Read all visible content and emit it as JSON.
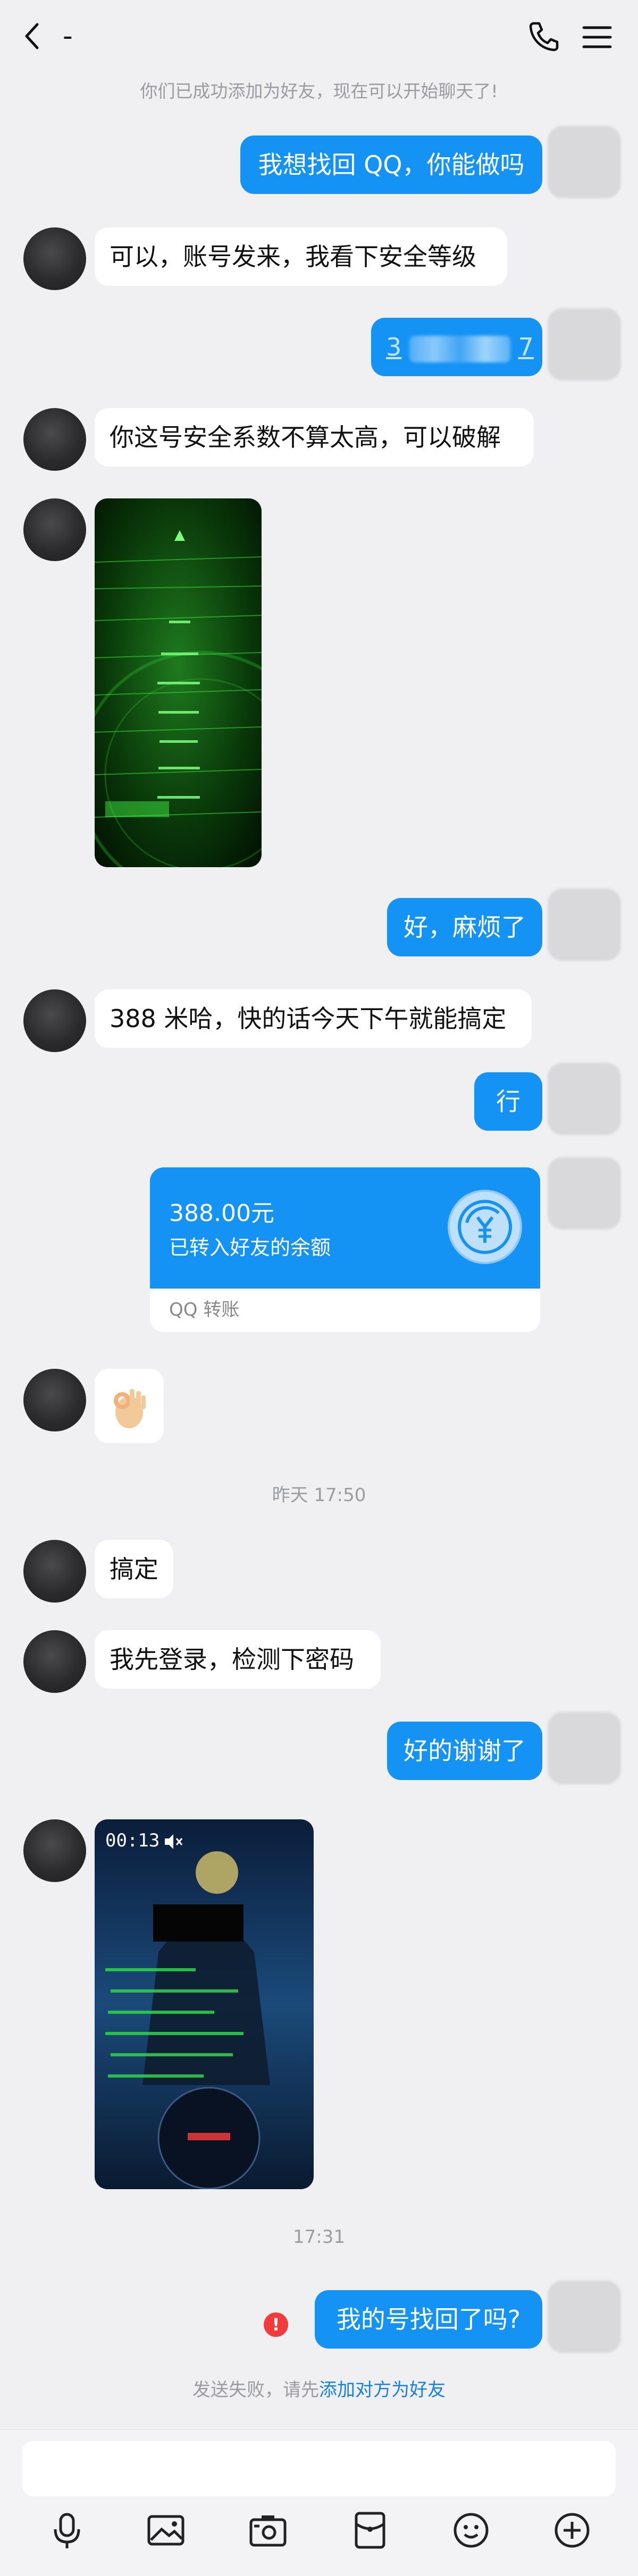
{
  "header": {
    "title": "-"
  },
  "system_notice": "你们已成功添加为好友，现在可以开始聊天了!",
  "messages": {
    "m1": "我想找回 QQ，你能做吗",
    "m2": "可以，账号发来，我看下安全等级",
    "m3_prefix": "3",
    "m3_suffix": "7",
    "m4": "你这号安全系数不算太高，可以破解",
    "m5": "好，麻烦了",
    "m6": "388 米哈，快的话今天下午就能搞定",
    "m7": "行",
    "m8": "搞定",
    "m9": "我先登录，检测下密码",
    "m10": "好的谢谢了",
    "m11": "我的号找回了吗?"
  },
  "transfer": {
    "amount": "388.00元",
    "desc": "已转入好友的余额",
    "footer": "QQ 转账",
    "icon": "yen-coin-icon"
  },
  "timestamps": {
    "t1": "昨天 17:50",
    "t2": "17:31"
  },
  "send_fail": {
    "text": "发送失败，请先",
    "link": "添加对方为好友"
  },
  "video": {
    "duration": "00:13"
  },
  "toolbar": [
    "mic-icon",
    "image-icon",
    "camera-icon",
    "red-packet-icon",
    "emoji-icon",
    "plus-icon"
  ],
  "colors": {
    "accent": "#1493f5",
    "background": "#f0f0f3",
    "error": "#f23c3c",
    "link": "#1880e0"
  }
}
